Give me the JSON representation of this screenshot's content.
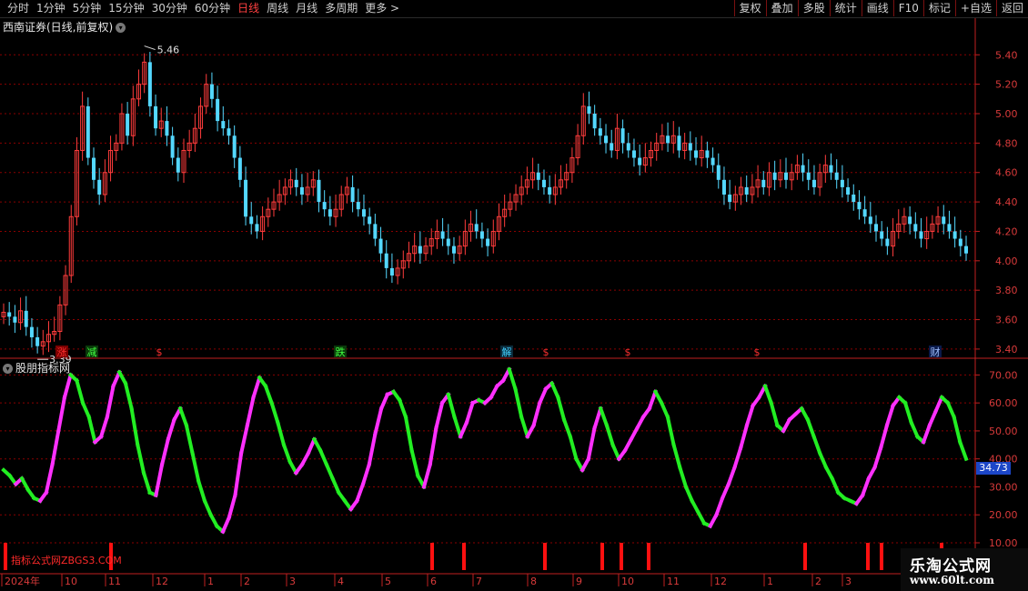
{
  "toolbar": {
    "periods": [
      "分时",
      "1分钟",
      "5分钟",
      "15分钟",
      "30分钟",
      "60分钟",
      "日线",
      "周线",
      "月线",
      "多周期",
      "更多 >"
    ],
    "active_period": "日线",
    "tools": [
      "复权",
      "叠加",
      "多股",
      "统计",
      "画线",
      "F10",
      "标记",
      "+自选",
      "返回"
    ]
  },
  "main_panel": {
    "title": "西南证券(日线,前复权)",
    "price_axis": [
      "5.40",
      "5.20",
      "5.00",
      "4.80",
      "4.60",
      "4.40",
      "4.20",
      "4.00",
      "3.80",
      "3.60",
      "3.40"
    ],
    "high_label": "5.46",
    "low_label": "3.39",
    "markers": [
      {
        "text": "涨",
        "color": "#ff3030",
        "bg": "#7a0000"
      },
      {
        "text": "减",
        "color": "#40ff40",
        "bg": "#0a3a0a"
      },
      {
        "text": "$",
        "color": "#ff3030",
        "bg": ""
      },
      {
        "text": "跌",
        "color": "#40ff40",
        "bg": "#0a3a0a"
      },
      {
        "text": "解",
        "color": "#40d0ff",
        "bg": "#0a2a3a"
      },
      {
        "text": "$",
        "color": "#ff3030",
        "bg": ""
      },
      {
        "text": "$",
        "color": "#ff3030",
        "bg": ""
      },
      {
        "text": "$",
        "color": "#ff3030",
        "bg": ""
      },
      {
        "text": "财",
        "color": "#a0c0ff",
        "bg": "#0a1a4a"
      }
    ]
  },
  "indicator_panel": {
    "title": "股朋指标网",
    "axis": [
      "70.00",
      "60.00",
      "50.00",
      "40.00",
      "30.00",
      "20.00",
      "10.00"
    ],
    "last_value": "34.73",
    "site_mark": "指标公式网ZBGS3.COM"
  },
  "date_axis": [
    "2024年",
    "10",
    "11",
    "12",
    "1",
    "2",
    "3",
    "4",
    "5",
    "6",
    "7",
    "8",
    "9",
    "10",
    "11",
    "12",
    "1",
    "2",
    "3"
  ],
  "watermark": {
    "line1": "乐淘公式网",
    "line2": "www.60lt.com"
  },
  "colors": {
    "up": "#ff3c3c",
    "down": "#54d8ff",
    "rising": "#ff30ff",
    "falling": "#22ee22",
    "grid": "#8a0000",
    "axis": "#c02020",
    "signal": "#ff1010"
  },
  "chart_data": {
    "type": "line",
    "price_range": [
      3.35,
      5.55
    ],
    "indicator_range": [
      10,
      75
    ],
    "close_series": [
      3.65,
      3.62,
      3.58,
      3.66,
      3.55,
      3.48,
      3.42,
      3.45,
      3.5,
      3.52,
      3.7,
      3.9,
      4.3,
      4.75,
      5.05,
      4.7,
      4.55,
      4.45,
      4.6,
      4.75,
      4.8,
      5.0,
      4.85,
      5.1,
      5.2,
      5.35,
      5.05,
      4.9,
      4.95,
      4.85,
      4.7,
      4.6,
      4.75,
      4.8,
      4.9,
      5.05,
      5.2,
      5.1,
      4.95,
      4.9,
      4.85,
      4.7,
      4.55,
      4.3,
      4.25,
      4.2,
      4.3,
      4.35,
      4.4,
      4.45,
      4.5,
      4.55,
      4.5,
      4.45,
      4.5,
      4.55,
      4.4,
      4.35,
      4.3,
      4.35,
      4.45,
      4.5,
      4.4,
      4.35,
      4.3,
      4.25,
      4.15,
      4.05,
      3.95,
      3.9,
      3.95,
      4.0,
      4.05,
      4.1,
      4.05,
      4.1,
      4.15,
      4.2,
      4.15,
      4.1,
      4.05,
      4.1,
      4.2,
      4.25,
      4.2,
      4.15,
      4.1,
      4.2,
      4.3,
      4.35,
      4.4,
      4.45,
      4.5,
      4.55,
      4.6,
      4.55,
      4.5,
      4.45,
      4.5,
      4.55,
      4.6,
      4.7,
      4.85,
      5.05,
      5.0,
      4.9,
      4.85,
      4.8,
      4.75,
      4.9,
      4.8,
      4.75,
      4.7,
      4.65,
      4.7,
      4.75,
      4.8,
      4.85,
      4.8,
      4.85,
      4.75,
      4.8,
      4.75,
      4.7,
      4.75,
      4.7,
      4.65,
      4.55,
      4.45,
      4.4,
      4.45,
      4.5,
      4.45,
      4.5,
      4.55,
      4.5,
      4.6,
      4.55,
      4.6,
      4.55,
      4.6,
      4.65,
      4.6,
      4.55,
      4.5,
      4.6,
      4.65,
      4.6,
      4.55,
      4.5,
      4.45,
      4.4,
      4.35,
      4.3,
      4.25,
      4.2,
      4.15,
      4.1,
      4.2,
      4.25,
      4.3,
      4.25,
      4.2,
      4.15,
      4.2,
      4.25,
      4.3,
      4.25,
      4.2,
      4.15,
      4.1,
      4.05
    ],
    "indicator_series": [
      36,
      34,
      31,
      33,
      29,
      26,
      25,
      28,
      38,
      50,
      62,
      70,
      68,
      60,
      55,
      46,
      48,
      55,
      66,
      71,
      67,
      58,
      45,
      35,
      28,
      27,
      38,
      47,
      54,
      58,
      52,
      42,
      32,
      25,
      20,
      16,
      14,
      19,
      27,
      42,
      52,
      62,
      69,
      66,
      60,
      53,
      45,
      39,
      35,
      38,
      42,
      47,
      43,
      38,
      33,
      28,
      25,
      22,
      25,
      31,
      38,
      49,
      58,
      63,
      64,
      61,
      55,
      43,
      34,
      30,
      38,
      51,
      60,
      63,
      55,
      48,
      53,
      60,
      61,
      60,
      62,
      66,
      68,
      72,
      65,
      55,
      48,
      52,
      60,
      65,
      67,
      62,
      54,
      48,
      40,
      36,
      40,
      51,
      58,
      52,
      45,
      40,
      43,
      47,
      51,
      55,
      58,
      64,
      60,
      55,
      45,
      37,
      30,
      25,
      21,
      17,
      16,
      20,
      26,
      31,
      37,
      44,
      52,
      59,
      62,
      66,
      60,
      52,
      50,
      54,
      56,
      58,
      54,
      48,
      42,
      37,
      33,
      28,
      26,
      25,
      24,
      27,
      33,
      37,
      44,
      52,
      59,
      62,
      60,
      53,
      48,
      46,
      52,
      57,
      62,
      60,
      55,
      46,
      40
    ]
  }
}
